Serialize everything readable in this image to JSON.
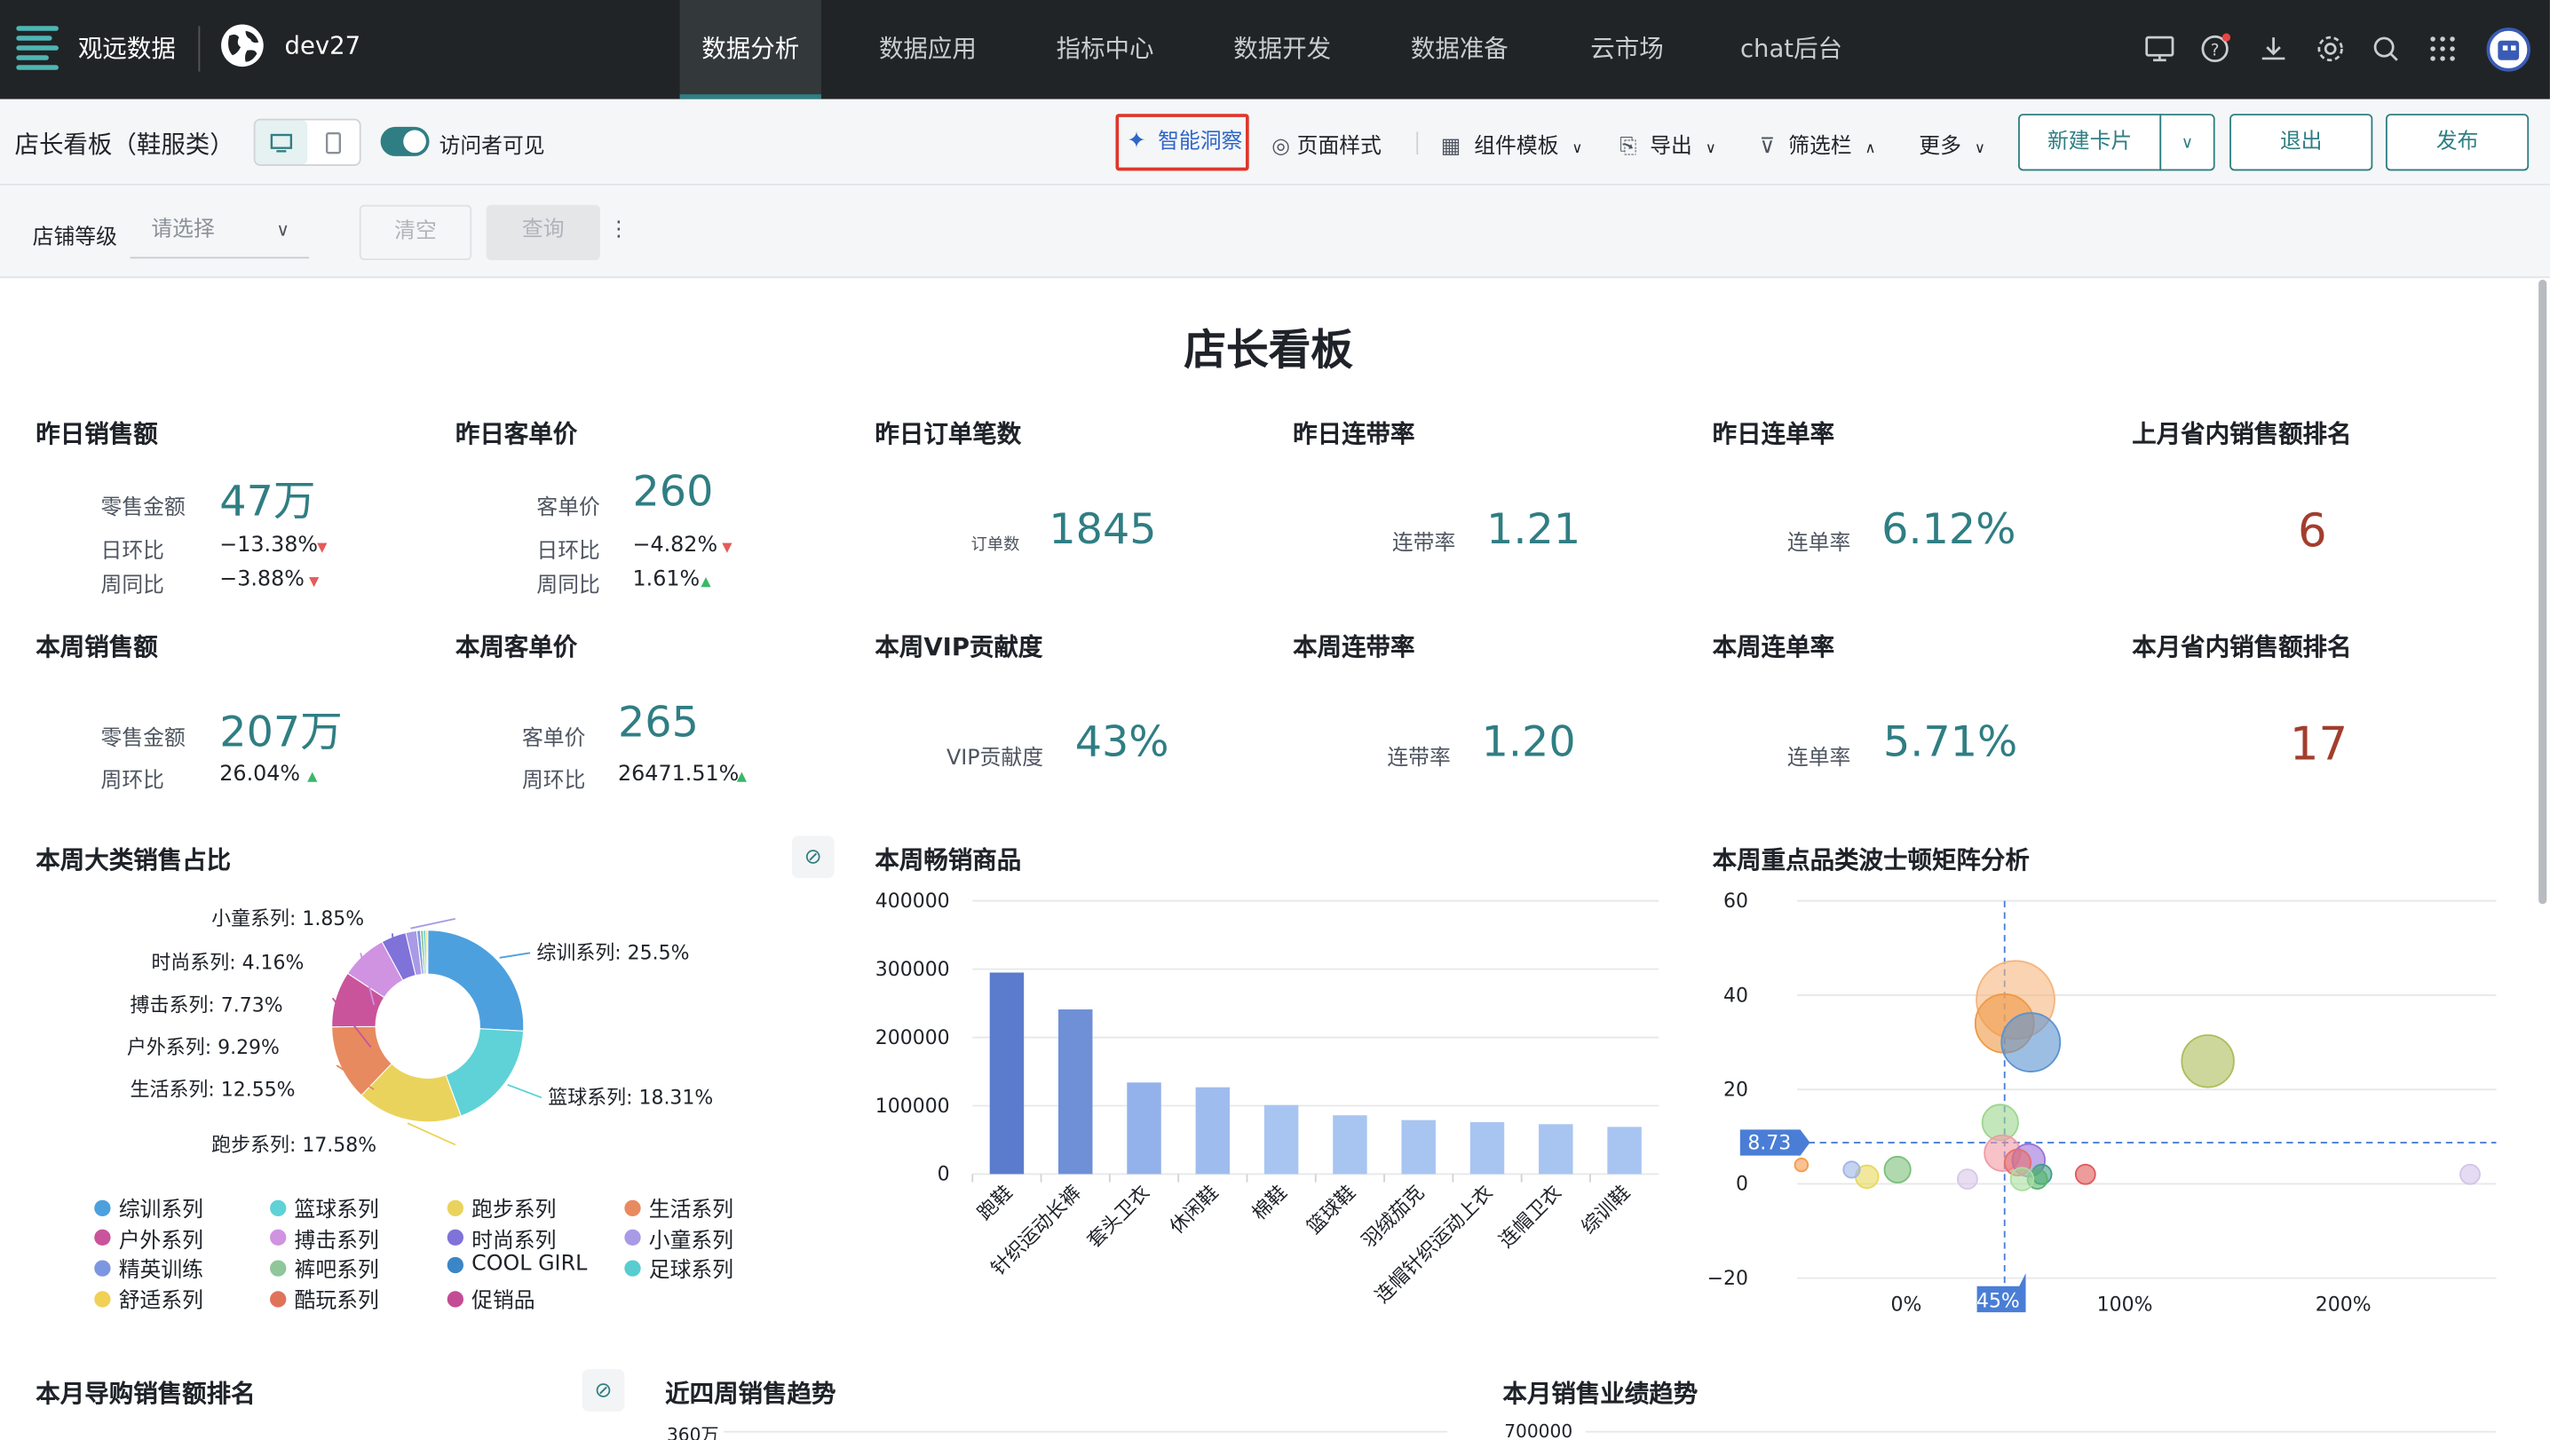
{
  "nav": {
    "brand": "观远数据",
    "project": "dev27",
    "tabs": [
      "数据分析",
      "数据应用",
      "指标中心",
      "数据开发",
      "数据准备",
      "云市场",
      "chat后台"
    ]
  },
  "toolbar": {
    "title": "店长看板（鞋服类）",
    "visitor_visible": "访问者可见",
    "insight": "智能洞察",
    "page_style": "页面样式",
    "component_template": "组件模板",
    "export": "导出",
    "filter_bar": "筛选栏",
    "more": "更多",
    "new_card": "新建卡片",
    "exit": "退出",
    "publish": "发布"
  },
  "filter": {
    "label": "店铺等级",
    "placeholder": "请选择",
    "clear": "清空",
    "query": "查询"
  },
  "dashboard": {
    "title": "店长看板",
    "kpis": {
      "yesterday_sales": {
        "title": "昨日销售额",
        "label": "零售金额",
        "value": "47万",
        "dod_label": "日环比",
        "dod": "−13.38%",
        "wow_label": "周同比",
        "wow": "−3.88%"
      },
      "yesterday_price": {
        "title": "昨日客单价",
        "label": "客单价",
        "value": "260",
        "dod_label": "日环比",
        "dod": "−4.82%",
        "wow_label": "周同比",
        "wow": "1.61%"
      },
      "yesterday_orders": {
        "title": "昨日订单笔数",
        "label": "订单数",
        "value": "1845"
      },
      "yesterday_attach": {
        "title": "昨日连带率",
        "label": "连带率",
        "value": "1.21"
      },
      "yesterday_multi": {
        "title": "昨日连单率",
        "label": "连单率",
        "value": "6.12%"
      },
      "last_month_rank": {
        "title": "上月省内销售额排名",
        "value": "6"
      },
      "week_sales": {
        "title": "本周销售额",
        "label": "零售金额",
        "value": "207万",
        "wow_label": "周环比",
        "wow": "26.04%"
      },
      "week_price": {
        "title": "本周客单价",
        "label": "客单价",
        "value": "265",
        "wow_label": "周环比",
        "wow": "26471.51%"
      },
      "week_vip": {
        "title": "本周VIP贡献度",
        "label": "VIP贡献度",
        "value": "43%"
      },
      "week_attach": {
        "title": "本周连带率",
        "label": "连带率",
        "value": "1.20"
      },
      "week_multi": {
        "title": "本周连单率",
        "label": "连单率",
        "value": "5.71%"
      },
      "month_rank": {
        "title": "本月省内销售额排名",
        "value": "17"
      }
    },
    "section_titles": {
      "category_share": "本周大类销售占比",
      "best_sellers": "本周畅销商品",
      "bcg": "本周重点品类波士顿矩阵分析",
      "guide_rank": "本月导购销售额排名",
      "four_week": "近四周销售趋势",
      "month_trend": "本月销售业绩趋势"
    },
    "bottom_axis": {
      "four_week_top": "360万",
      "month_trend_top": "700000"
    },
    "pie_legend": [
      {
        "name": "综训系列",
        "color": "#4da0de"
      },
      {
        "name": "篮球系列",
        "color": "#5ed2d6"
      },
      {
        "name": "跑步系列",
        "color": "#ead35c"
      },
      {
        "name": "生活系列",
        "color": "#e88a5f"
      },
      {
        "name": "户外系列",
        "color": "#c9549b"
      },
      {
        "name": "搏击系列",
        "color": "#cf93e2"
      },
      {
        "name": "时尚系列",
        "color": "#7f72d9"
      },
      {
        "name": "小童系列",
        "color": "#a99ae6"
      },
      {
        "name": "精英训练",
        "color": "#7c96e0"
      },
      {
        "name": "裤吧系列",
        "color": "#8fc69a"
      },
      {
        "name": "COOL GIRL",
        "color": "#3b86c7"
      },
      {
        "name": "足球系列",
        "color": "#58cdcf"
      },
      {
        "name": "舒适系列",
        "color": "#f0d055"
      },
      {
        "name": "酷玩系列",
        "color": "#e0725a"
      },
      {
        "name": "促销品",
        "color": "#c44c94"
      }
    ]
  },
  "chart_data": [
    {
      "type": "pie",
      "title": "本周大类销售占比",
      "slices": [
        {
          "label": "综训系列: 25.5%",
          "value": 25.5,
          "color": "#4da0de"
        },
        {
          "label": "篮球系列: 18.31%",
          "value": 18.31,
          "color": "#5ed2d6"
        },
        {
          "label": "跑步系列: 17.58%",
          "value": 17.58,
          "color": "#ead35c"
        },
        {
          "label": "生活系列: 12.55%",
          "value": 12.55,
          "color": "#e88a5f"
        },
        {
          "label": "户外系列: 9.29%",
          "value": 9.29,
          "color": "#c9549b"
        },
        {
          "label": "搏击系列: 7.73%",
          "value": 7.73,
          "color": "#cf93e2"
        },
        {
          "label": "时尚系列: 4.16%",
          "value": 4.16,
          "color": "#7f72d9"
        },
        {
          "label": "小童系列: 1.85%",
          "value": 1.85,
          "color": "#a99ae6"
        },
        {
          "label": "",
          "value": 0.6,
          "color": "#7c96e0"
        },
        {
          "label": "",
          "value": 0.5,
          "color": "#8fc69a"
        },
        {
          "label": "",
          "value": 0.4,
          "color": "#58cdcf"
        },
        {
          "label": "",
          "value": 0.3,
          "color": "#f0d055"
        }
      ]
    },
    {
      "type": "bar",
      "title": "本周畅销商品",
      "categories": [
        "跑鞋",
        "针织运动长裤",
        "套头卫衣",
        "休闲鞋",
        "棉鞋",
        "篮球鞋",
        "羽绒茄克",
        "连帽针织运动上衣",
        "连帽卫衣",
        "综训鞋"
      ],
      "values": [
        295000,
        241000,
        134000,
        127000,
        101000,
        86000,
        79000,
        76000,
        73000,
        69000
      ],
      "colors": [
        "#5b7ccc",
        "#6f8fd6",
        "#93b1ea",
        "#9fbcee",
        "#a8c5f1",
        "#a8c5f1",
        "#a8c5f1",
        "#a8c5f1",
        "#a8c5f1",
        "#a8c5f1"
      ],
      "ylim": [
        0,
        400000
      ],
      "yticks": [
        "0",
        "100000",
        "200000",
        "300000",
        "400000"
      ]
    },
    {
      "type": "scatter",
      "title": "本周重点品类波士顿矩阵分析",
      "xlim": [
        -0.5,
        2.7
      ],
      "ylim": [
        -20,
        60
      ],
      "xticks": [
        "0%",
        "100%",
        "200%"
      ],
      "yticks": [
        "60",
        "40",
        "20",
        "0",
        "−20"
      ],
      "ref_y": "8.73",
      "ref_x": "45%",
      "points": [
        {
          "x": 0.5,
          "y": 39,
          "r": 24,
          "color": "#f5b57e"
        },
        {
          "x": 0.45,
          "y": 34,
          "r": 18,
          "color": "#ef9a45"
        },
        {
          "x": 0.57,
          "y": 30,
          "r": 18,
          "color": "#5b93d0"
        },
        {
          "x": 1.38,
          "y": 26,
          "r": 16,
          "color": "#adbd58"
        },
        {
          "x": 0.43,
          "y": 13,
          "r": 11,
          "color": "#9cd68e"
        },
        {
          "x": 0.44,
          "y": 6.5,
          "r": 11,
          "color": "#f19aa3"
        },
        {
          "x": 0.56,
          "y": 5,
          "r": 10,
          "color": "#9b72d9"
        },
        {
          "x": 0.51,
          "y": 4.5,
          "r": 8,
          "color": "#e46f6f"
        },
        {
          "x": 0.62,
          "y": 2,
          "r": 6,
          "color": "#3fa089"
        },
        {
          "x": 0.6,
          "y": 1,
          "r": 6,
          "color": "#5ab46e"
        },
        {
          "x": -0.04,
          "y": 3,
          "r": 8,
          "color": "#7cc07c"
        },
        {
          "x": -0.18,
          "y": 1.5,
          "r": 7,
          "color": "#e8d85a"
        },
        {
          "x": -0.25,
          "y": 3,
          "r": 5,
          "color": "#9fb6e6"
        },
        {
          "x": 0.28,
          "y": 1,
          "r": 6,
          "color": "#d8c7e8"
        },
        {
          "x": 0.53,
          "y": 1,
          "r": 7,
          "color": "#a8e0a0"
        },
        {
          "x": 0.82,
          "y": 2,
          "r": 6,
          "color": "#e05a5a"
        },
        {
          "x": -0.48,
          "y": 4,
          "r": 4,
          "color": "#f59a4a"
        },
        {
          "x": 2.58,
          "y": 2,
          "r": 6,
          "color": "#d4c3ea"
        }
      ]
    }
  ]
}
